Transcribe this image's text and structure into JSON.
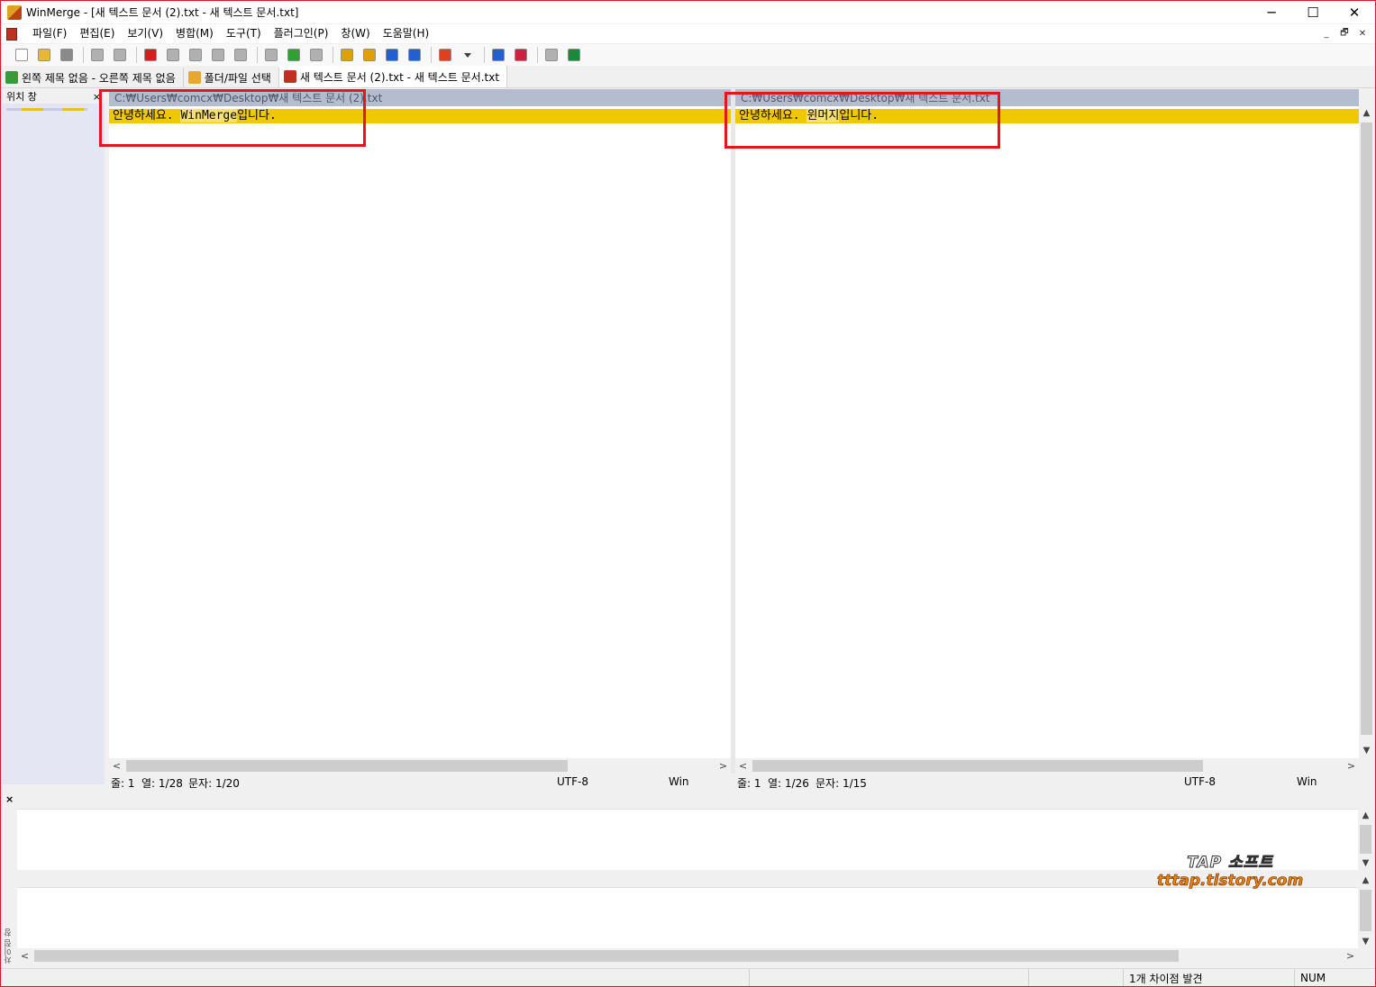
{
  "window": {
    "title": "WinMerge - [새 텍스트 문서 (2).txt - 새 텍스트 문서.txt]",
    "buttons": [
      "─",
      "☐",
      "✕"
    ]
  },
  "menu": {
    "items": [
      "파일(F)",
      "편집(E)",
      "보기(V)",
      "병합(M)",
      "도구(T)",
      "플러그인(P)",
      "창(W)",
      "도움말(H)"
    ],
    "mdi_buttons": [
      "_",
      "🗗",
      "✕"
    ]
  },
  "toolbar": {
    "icons": [
      {
        "name": "new-icon",
        "color": "#ffffff"
      },
      {
        "name": "open-icon",
        "color": "#e8b830"
      },
      {
        "name": "save-icon",
        "color": "#8a8a8a"
      },
      {
        "name": "undo-icon",
        "color": "#b0b0b0"
      },
      {
        "name": "redo-icon",
        "color": "#b0b0b0"
      },
      {
        "name": "current-diff-icon",
        "color": "#d02020"
      },
      {
        "name": "next-diff-icon",
        "color": "#b0b0b0"
      },
      {
        "name": "prev-diff-icon",
        "color": "#b0b0b0"
      },
      {
        "name": "first-diff-icon",
        "color": "#b0b0b0"
      },
      {
        "name": "last-diff-icon",
        "color": "#b0b0b0"
      },
      {
        "name": "prev-conflict-icon",
        "color": "#b0b0b0"
      },
      {
        "name": "all-diffs-icon",
        "color": "#30a030"
      },
      {
        "name": "next-conflict-icon",
        "color": "#b0b0b0"
      },
      {
        "name": "copy-right-icon",
        "color": "#e0a000"
      },
      {
        "name": "copy-left-icon",
        "color": "#e0a000"
      },
      {
        "name": "copy-right-advance-icon",
        "color": "#2060d0"
      },
      {
        "name": "copy-left-advance-icon",
        "color": "#2060d0"
      },
      {
        "name": "options-icon",
        "color": "#e04020"
      },
      {
        "name": "dropdown-icon",
        "color": "#404040"
      },
      {
        "name": "open-left-icon",
        "color": "#2060d0"
      },
      {
        "name": "open-right-icon",
        "color": "#d02040"
      },
      {
        "name": "merge-icon",
        "color": "#b0b0b0"
      },
      {
        "name": "refresh-icon",
        "color": "#1a8a3a"
      }
    ]
  },
  "tabs": [
    {
      "label": "왼쪽 제목 없음 - 오른쪽 제목 없음",
      "active": false
    },
    {
      "label": "폴더/파일 선택",
      "active": false
    },
    {
      "label": "새 텍스트 문서 (2).txt - 새 텍스트 문서.txt",
      "active": true
    }
  ],
  "location_pane": {
    "title": "위치 창",
    "close": "×"
  },
  "left": {
    "path": "C:₩Users₩comcx₩Desktop₩새 텍스트 문서 (2).txt",
    "line_prefix": "안녕하세요. ",
    "line_diff": "WinMerge",
    "line_suffix": "입니다.",
    "status": {
      "line": "줄: 1",
      "col": "열: 1/28",
      "char": "문자: 1/20",
      "encoding": "UTF-8",
      "eol": "Win"
    }
  },
  "right": {
    "path": "C:₩Users₩comcx₩Desktop₩새 텍스트 문서.txt",
    "line_prefix": "안녕하세요. ",
    "line_diff": "윈머지",
    "line_suffix": "입니다.",
    "status": {
      "line": "줄: 1",
      "col": "열: 1/26",
      "char": "문자: 1/15",
      "encoding": "UTF-8",
      "eol": "Win"
    }
  },
  "diff_pane": {
    "close": "×",
    "vertical_label": "차이점 창"
  },
  "watermark": {
    "line1": "TAP 소프트",
    "line2": "tttap.tistory.com"
  },
  "statusbar": {
    "message": "1개 차이점 발견",
    "num": "NUM"
  },
  "colors": {
    "diff_line": "#f0c800",
    "diff_word": "#f8e070",
    "header": "#b4bdd0",
    "annotation": "#e8141c"
  }
}
